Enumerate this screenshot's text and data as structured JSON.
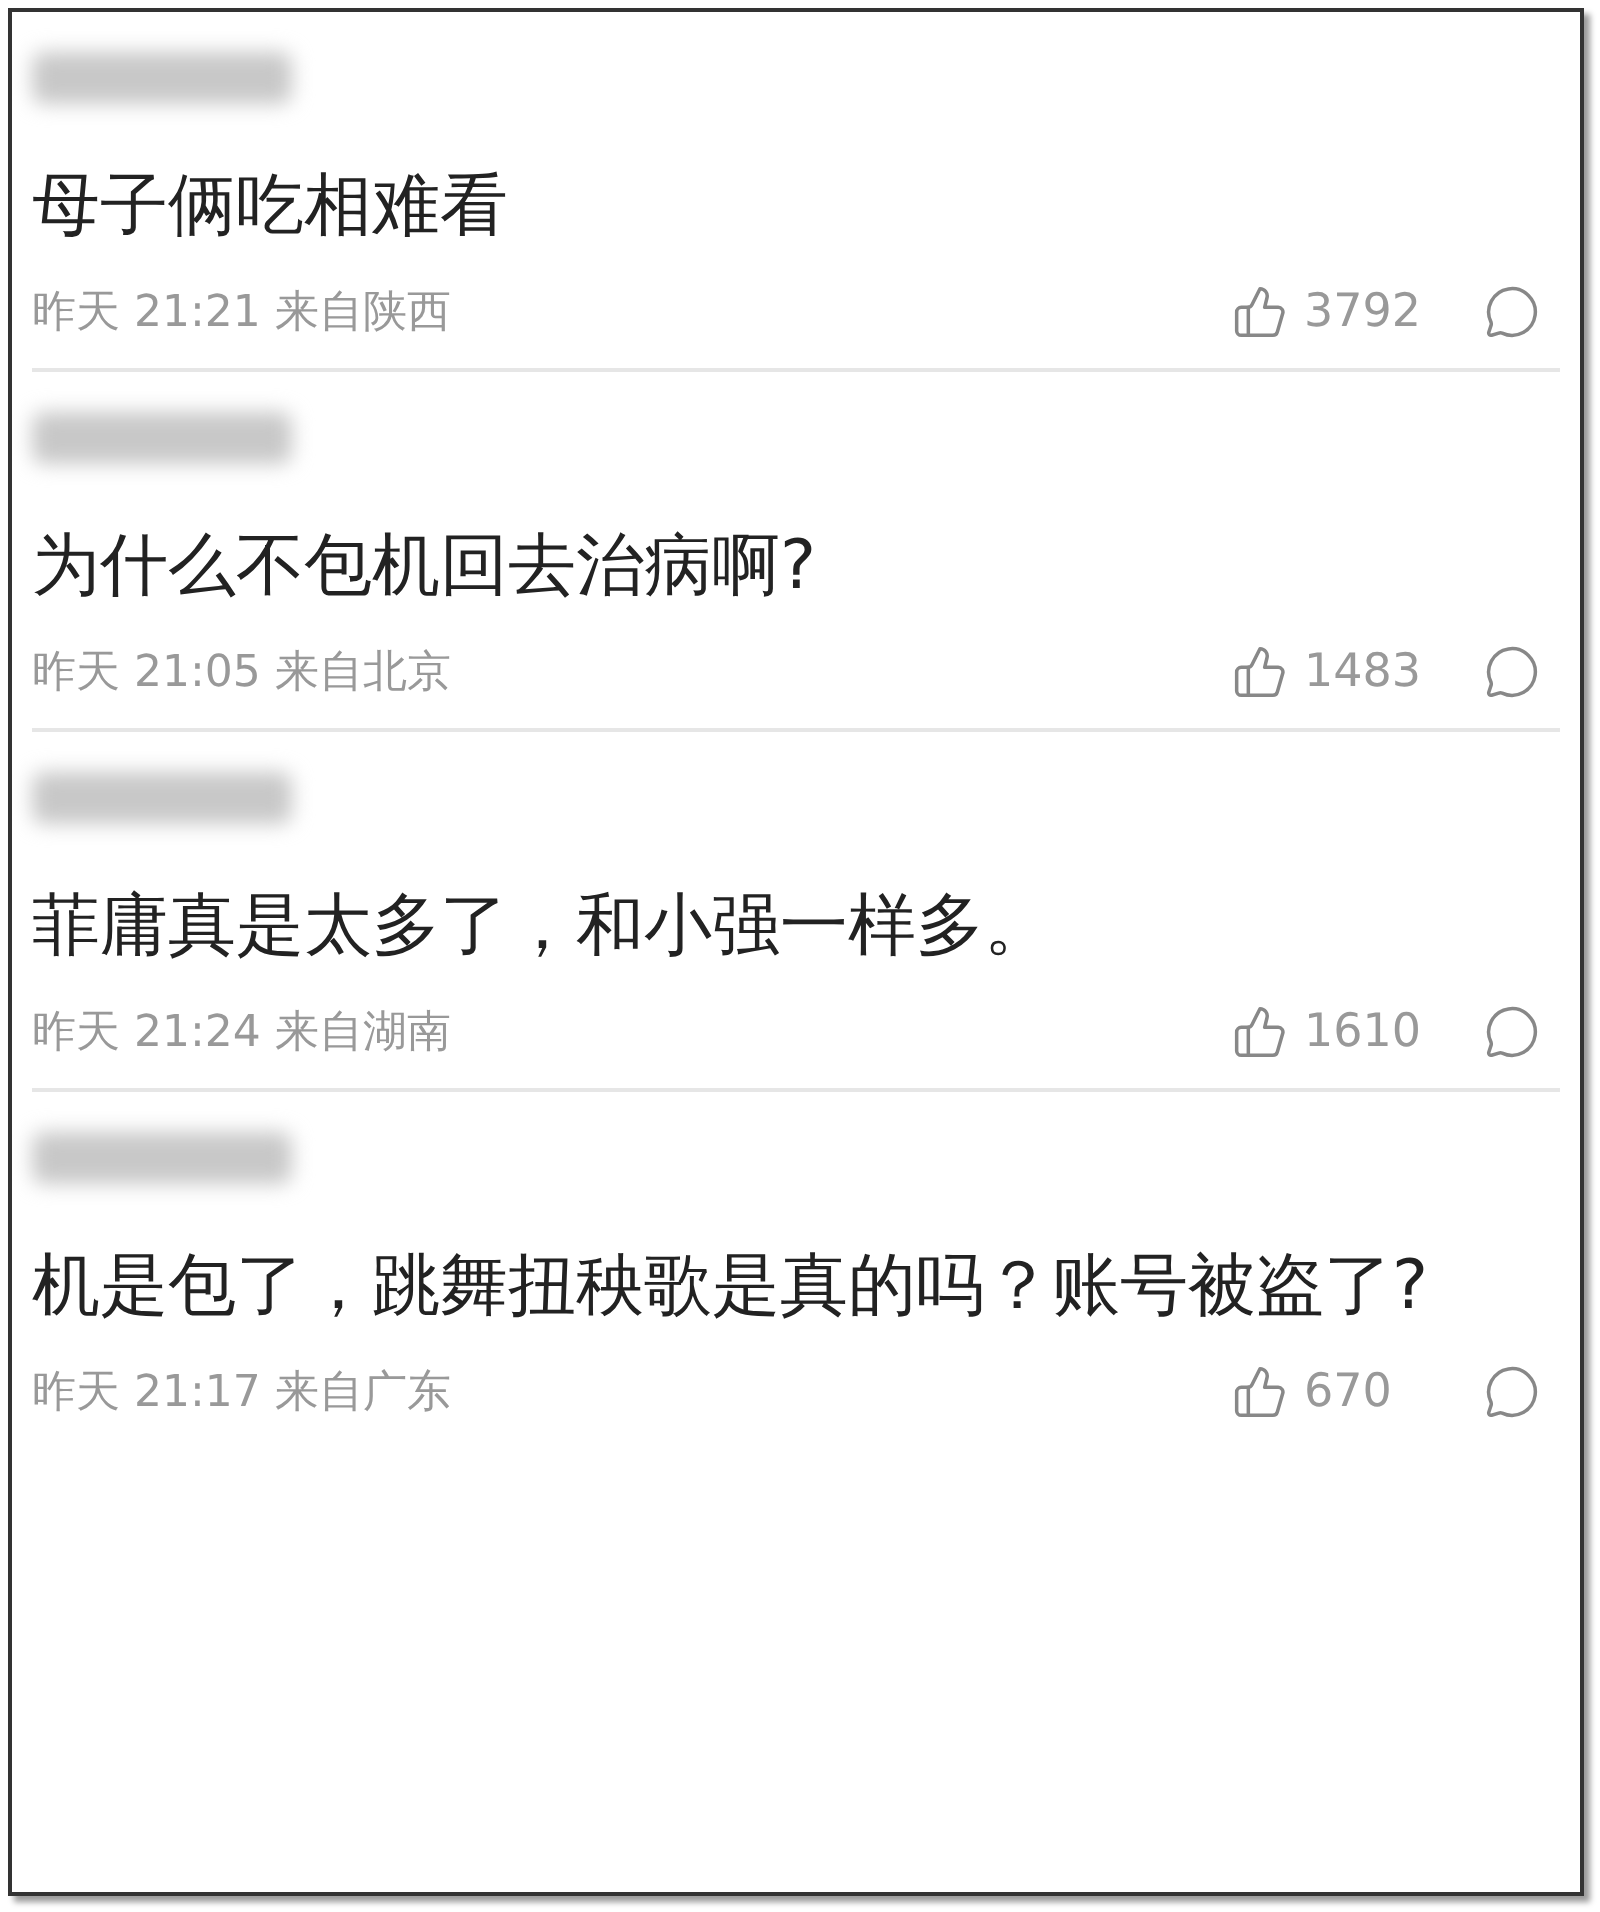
{
  "comments": [
    {
      "text": "母子俩吃相难看",
      "time": "昨天 21:21 来自陕西",
      "likes": "3792"
    },
    {
      "text": "为什么不包机回去治病啊?",
      "time": "昨天 21:05 来自北京",
      "likes": "1483"
    },
    {
      "text": "菲庸真是太多了，和小强一样多。",
      "time": "昨天 21:24 来自湖南",
      "likes": "1610"
    },
    {
      "text": "机是包了，跳舞扭秧歌是真的吗？账号被盗了?",
      "time": "昨天 21:17 来自广东",
      "likes": "670"
    }
  ]
}
